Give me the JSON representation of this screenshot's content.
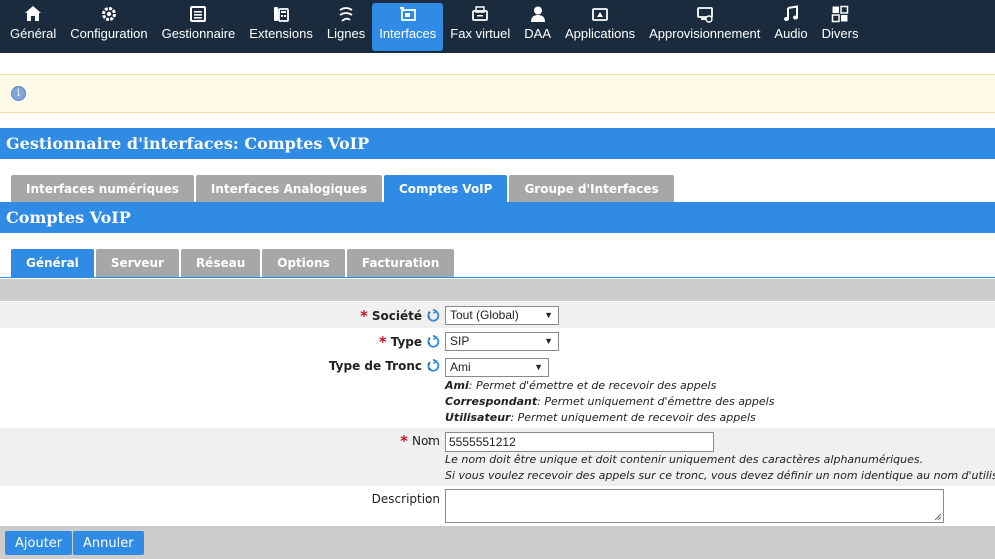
{
  "nav": {
    "items": [
      {
        "label": "Général",
        "icon": "home-icon"
      },
      {
        "label": "Configuration",
        "icon": "gear-icon"
      },
      {
        "label": "Gestionnaire",
        "icon": "list-icon"
      },
      {
        "label": "Extensions",
        "icon": "phone-icon"
      },
      {
        "label": "Lignes",
        "icon": "lines-icon"
      },
      {
        "label": "Interfaces",
        "icon": "interface-icon"
      },
      {
        "label": "Fax virtuel",
        "icon": "fax-icon"
      },
      {
        "label": "DAA",
        "icon": "user-icon"
      },
      {
        "label": "Applications",
        "icon": "applications-icon"
      },
      {
        "label": "Approvisionnement",
        "icon": "provisioning-icon"
      },
      {
        "label": "Audio",
        "icon": "music-icon"
      },
      {
        "label": "Divers",
        "icon": "misc-icon"
      }
    ],
    "active_index": 5
  },
  "info": {
    "icon": "info-icon"
  },
  "header1": {
    "title": "Gestionnaire d'interfaces:  Comptes VoIP"
  },
  "tabs1": {
    "items": [
      "Interfaces numériques",
      "Interfaces Analogiques",
      "Comptes VoIP",
      "Groupe d'Interfaces"
    ],
    "active_index": 2
  },
  "header2": {
    "title": "Comptes VoIP"
  },
  "tabs2": {
    "items": [
      "Général",
      "Serveur",
      "Réseau",
      "Options",
      "Facturation"
    ],
    "active_index": 0
  },
  "form": {
    "societe": {
      "label": "Société",
      "value": "Tout (Global)"
    },
    "type": {
      "label": "Type",
      "value": "SIP"
    },
    "type_tronc": {
      "label": "Type de Tronc",
      "value": "Ami",
      "help": [
        {
          "term": "Ami",
          "text": ": Permet d'émettre et de recevoir des appels"
        },
        {
          "term": "Correspondant",
          "text": ": Permet uniquement d'émettre des appels"
        },
        {
          "term": "Utilisateur",
          "text": ": Permet uniquement de recevoir des appels"
        }
      ]
    },
    "nom": {
      "label": "Nom",
      "value": "5555551212",
      "help1": "Le nom doit être unique et doit contenir uniquement des caractères alphanumériques.",
      "help2": "Si vous voulez recevoir des appels sur ce tronc, vous devez définir un nom identique au nom d'utilisateur."
    },
    "description": {
      "label": "Description",
      "value": ""
    },
    "colon": ":"
  },
  "buttons": {
    "add": "Ajouter",
    "cancel": "Annuler"
  },
  "colors": {
    "nav_bg": "#1a2b3e",
    "accent": "#2f8be4",
    "tab_inactive": "#a7a7a7",
    "required": "#c0181e"
  }
}
